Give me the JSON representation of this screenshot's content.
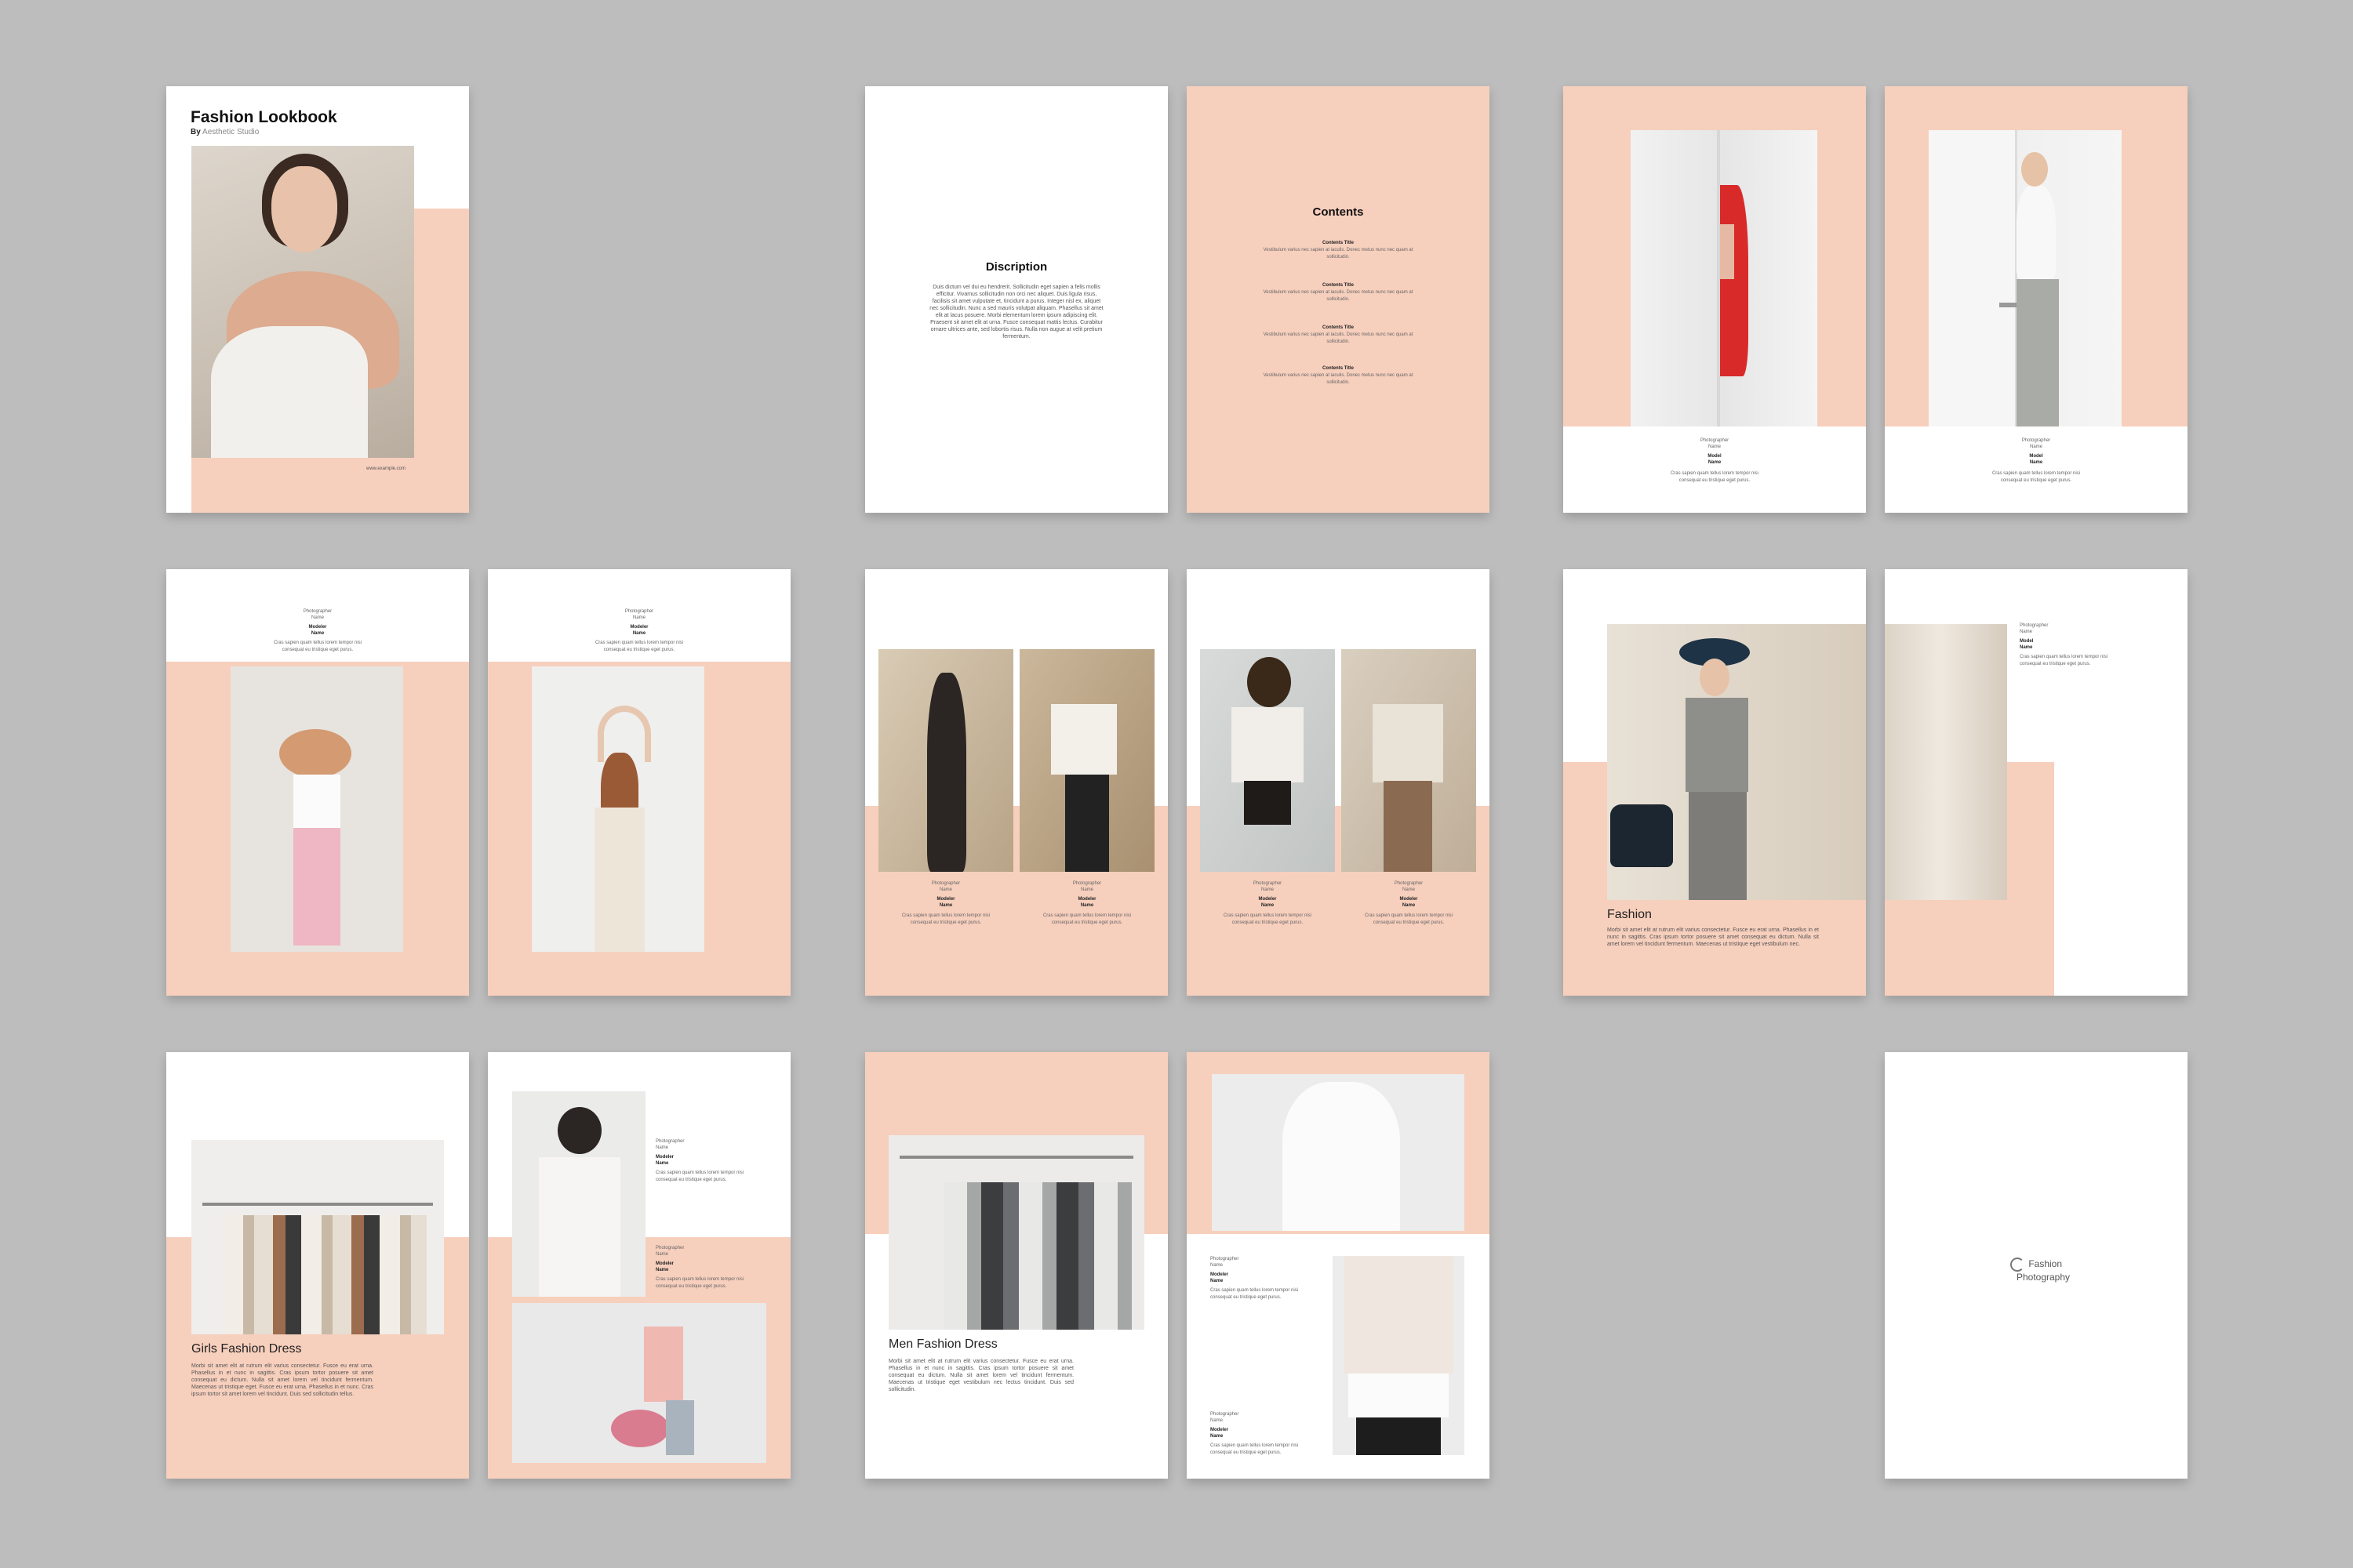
{
  "colors": {
    "background": "#bdbdbd",
    "accent": "#f7cfbd",
    "page": "#ffffff"
  },
  "cover": {
    "title": "Fashion Lookbook",
    "by": "By",
    "studio": "Aesthetic Studio",
    "url": "www.example.com"
  },
  "description": {
    "heading": "Discription",
    "body": "Duis dictum vel dui eu hendrerit. Sollicitudin eget sapien a felis mollis efficitur. Vivamus sollicitudin non orci nec aliquet. Duis ligula risus, facilisis sit amet vulputate et, tincidunt a purus. Integer nisl ex, aliquet nec sollicitudin. Nunc a sed mauris volutpat aliquam. Phasellus sit amet elit at lacus posuere. Morbi elementum lorem ipsum adipiscing elit. Praesent sit amet elit at urna. Fusce consequat mattis lectus. Curabitur ornare ultrices ante, sed lobortis risus. Nulla non augue at velit pretium fermentum."
  },
  "contents": {
    "heading": "Contents",
    "items": [
      {
        "title": "Contents Title",
        "desc": "Vestibulum varius nec sapien at iaculis. Donec metus nunc nec quam at sollicitudin."
      },
      {
        "title": "Contents Title",
        "desc": "Vestibulum varius nec sapien at iaculis. Donec metus nunc nec quam at sollicitudin."
      },
      {
        "title": "Contents Title",
        "desc": "Vestibulum varius nec sapien at iaculis. Donec metus nunc nec quam at sollicitudin."
      },
      {
        "title": "Contents Title",
        "desc": "Vestibulum varius nec sapien at iaculis. Donec metus nunc nec quam at sollicitudin."
      }
    ]
  },
  "credit": {
    "photographer": "Photographer",
    "name": "Name",
    "model": "Model",
    "modeler": "Modeler",
    "desc": "Cras sapien quam tellus lorem tempor nisi consequat eu tristique eget purus."
  },
  "fashion": {
    "title": "Fashion",
    "body": "Morbi sit amet elit at rutrum elit varius consectetur. Fusce eu erat urna. Phasellus in et nunc in sagittis. Cras ipsum tortor posuere sit amet consequat eu dictum. Nulla sit amet lorem vel tincidunt fermentum. Maecenas ut tristique eget vestibulum nec."
  },
  "girls": {
    "title": "Girls Fashion Dress",
    "body": "Morbi sit amet elit at rutrum elit varius consectetur. Fusce eu erat urna. Phasellus in et nunc in sagittis. Cras ipsum tortor posuere sit amet consequat eu dictum. Nulla sit amet lorem vel tincidunt fermentum. Maecenas ut tristique eget. Fusce eu erat urna. Phasellus in et nunc. Cras ipsum tortor sit amet lorem vel tincidunt. Duis sed sollicitudin tellus."
  },
  "men": {
    "title": "Men Fashion Dress",
    "body": "Morbi sit amet elit at rutrum elit varius consectetur. Fusce eu erat urna. Phasellus in et nunc in sagittis. Cras ipsum tortor posuere sit amet consequat eu dictum. Nulla sit amet lorem vel tincidunt fermentum. Maecenas ut tristique eget vestibulum nec lectus tincidunt. Duis sed sollicitudin."
  },
  "back": {
    "word1": "Fashion",
    "word2": "Photography"
  }
}
